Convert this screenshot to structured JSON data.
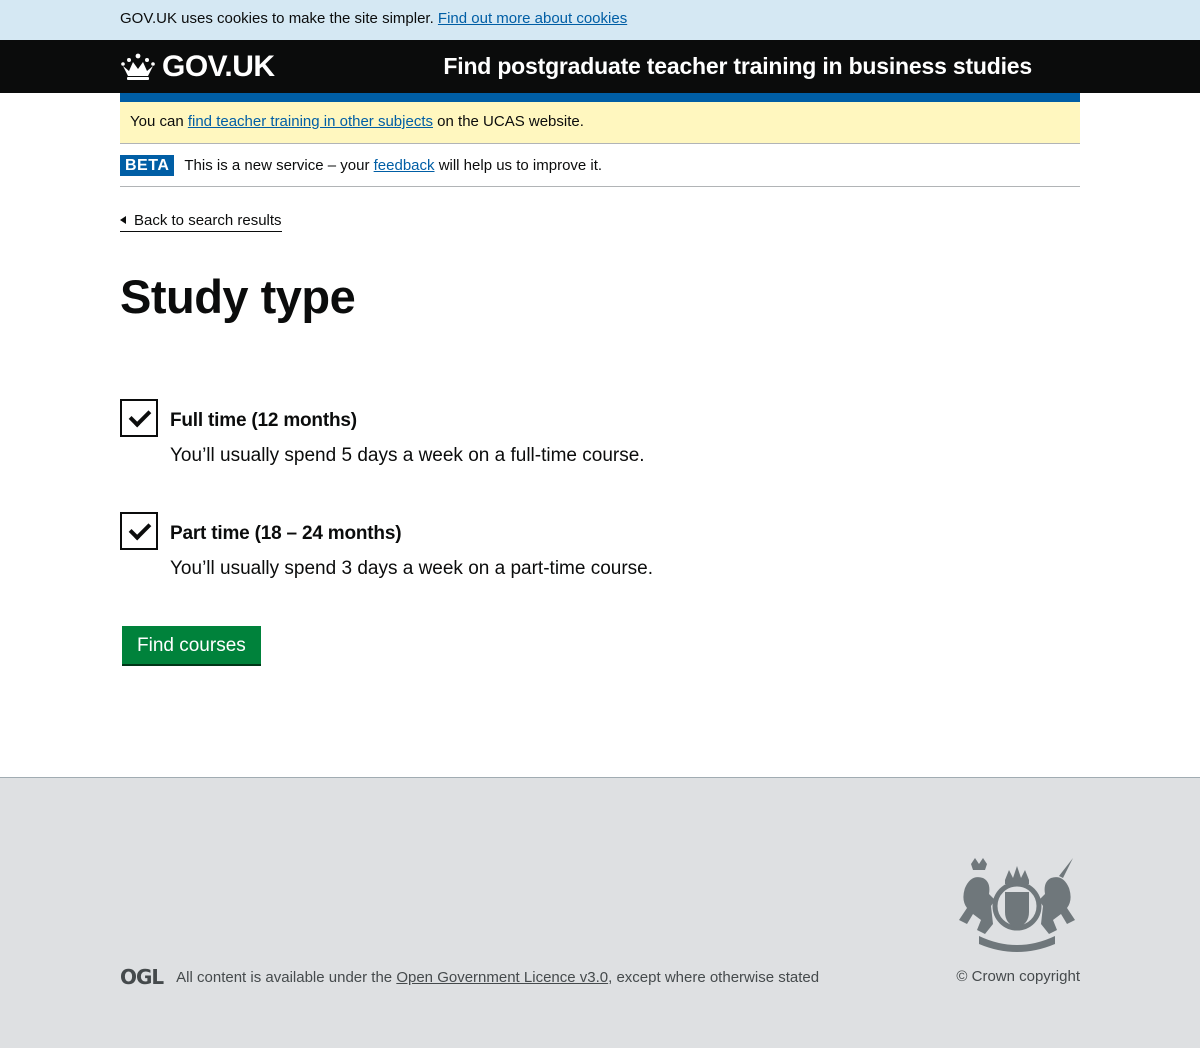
{
  "cookie_banner": {
    "text": "GOV.UK uses cookies to make the site simpler.",
    "link": "Find out more about cookies"
  },
  "header": {
    "logo_text": "GOV.UK",
    "logo_icon": "crown-icon",
    "service_name": "Find postgraduate teacher training in business studies"
  },
  "notice": {
    "prefix": "You can",
    "link": "find teacher training in other subjects",
    "suffix": "on the UCAS website."
  },
  "phase_banner": {
    "tag": "BETA",
    "prefix": "This is a new service – your",
    "link": "feedback",
    "suffix": "will help us to improve it."
  },
  "back_link": "Back to search results",
  "page_title": "Study type",
  "options": [
    {
      "label": "Full time (12 months)",
      "hint": "You’ll usually spend 5 days a week on a full-time course.",
      "checked": true
    },
    {
      "label": "Part time (18 – 24 months)",
      "hint": "You’ll usually spend 3 days a week on a part-time course.",
      "checked": true
    }
  ],
  "submit_label": "Find courses",
  "footer": {
    "ogl_logo": "OGL",
    "licence_prefix": "All content is available under the",
    "licence_link": "Open Government Licence v3.0",
    "licence_suffix": ", except where otherwise stated",
    "crest_icon": "royal-coat-of-arms-icon",
    "copyright": "© Crown copyright"
  },
  "colors": {
    "header_bg": "#0b0c0c",
    "cookie_bg": "#d5e8f3",
    "notice_bg": "#fff7bf",
    "link": "#005ea5",
    "button": "#00823b",
    "footer_bg": "#dee0e2"
  }
}
